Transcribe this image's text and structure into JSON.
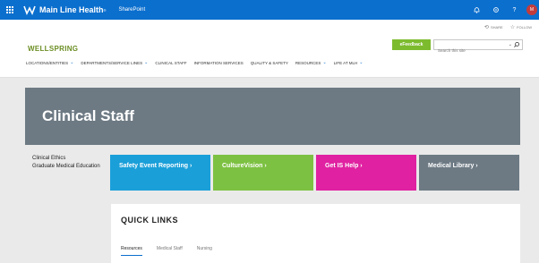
{
  "suite": {
    "brand_name": "Main Line Health",
    "brand_mark": "®",
    "app_name": "SharePoint",
    "icons": [
      "bell-icon",
      "gear-icon",
      "help-icon"
    ],
    "help_glyph": "?",
    "avatar_initials": "M"
  },
  "header": {
    "share_label": "SHARE",
    "follow_label": "FOLLOW",
    "logo": "WELLSPRING",
    "feedback_label": "eFeedback",
    "search_placeholder": "Search this site"
  },
  "nav": {
    "items": [
      {
        "label": "LOCATIONS/ENTITIES",
        "dropdown": true
      },
      {
        "label": "DEPARTMENTS/SERVICE LINES",
        "dropdown": true
      },
      {
        "label": "CLINICAL STAFF",
        "dropdown": false
      },
      {
        "label": "INFORMATION SERVICES",
        "dropdown": false
      },
      {
        "label": "QUALITY & SAFETY",
        "dropdown": false
      },
      {
        "label": "RESOURCES",
        "dropdown": true
      },
      {
        "label": "LIFE AT MLH",
        "dropdown": true
      }
    ]
  },
  "hero": {
    "title": "Clinical Staff"
  },
  "left_links": [
    "Clinical Ethics",
    "Graduate Medical Education"
  ],
  "tiles": [
    {
      "label": "Safety Event Reporting ›",
      "color": "#1a9fd9"
    },
    {
      "label": "CultureVision ›",
      "color": "#7dc142"
    },
    {
      "label": "Get IS Help ›",
      "color": "#e021a1"
    },
    {
      "label": "Medical Library ›",
      "color": "#6d7a84"
    }
  ],
  "quick_links": {
    "title": "QUICK LINKS",
    "tabs": [
      "Resources",
      "Medical Staff",
      "Nursing"
    ],
    "active_tab": "Resources"
  },
  "colors": {
    "suite_bar": "#0b6fce",
    "logo": "#6b8e23",
    "feedback": "#7dbb2e",
    "hero": "#6d7a84"
  }
}
